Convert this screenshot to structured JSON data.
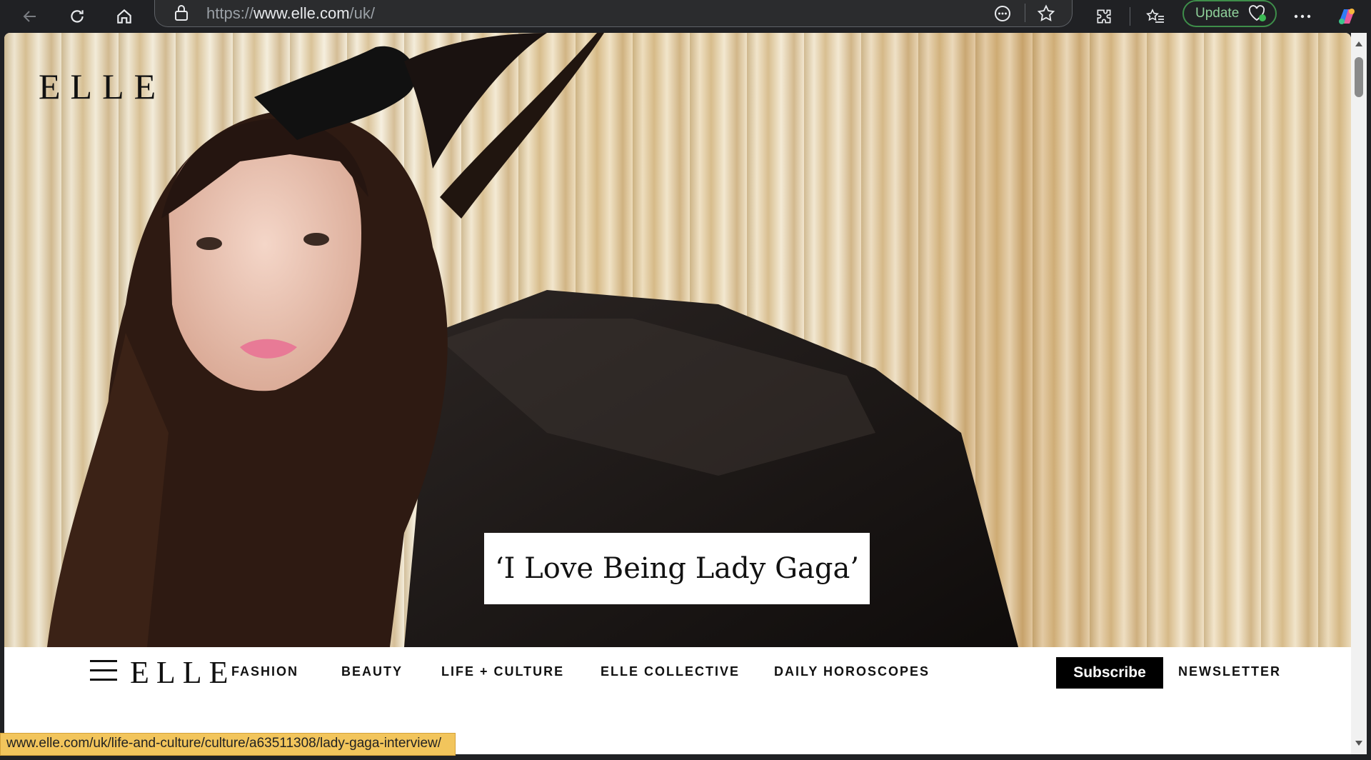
{
  "browser": {
    "url_prefix": "https://",
    "url_domain": "www.elle.com",
    "url_path": "/uk/",
    "update_label": "Update"
  },
  "hero": {
    "logo": "ELLE",
    "headline": "‘I Love Being Lady Gaga’"
  },
  "nav": {
    "logo": "ELLE",
    "items": [
      "FASHION",
      "BEAUTY",
      "LIFE + CULTURE",
      "ELLE COLLECTIVE",
      "DAILY HOROSCOPES"
    ],
    "subscribe": "Subscribe",
    "newsletter": "NEWSLETTER"
  },
  "status_bar": {
    "link": "www.elle.com/uk/life-and-culture/culture/a63511308/lady-gaga-interview/"
  }
}
